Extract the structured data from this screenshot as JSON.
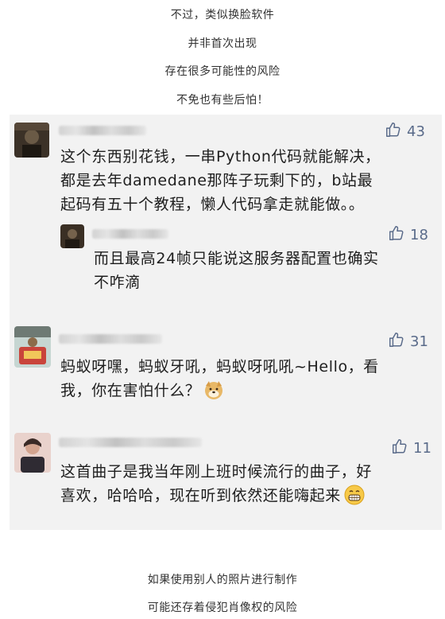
{
  "intro": [
    "不过，类似换脸软件",
    "并非首次出现",
    "存在很多可能性的风险",
    "不免也有些后怕！"
  ],
  "comments": [
    {
      "likes": "43",
      "text": [
        "这个东西别花钱，一串Python代码就能解决，",
        "都是去年damedane那阵子玩剩下的，b站最",
        "起码有五十个教程，懒人代码拿走就能做。。"
      ]
    },
    {
      "likes": "18",
      "text": [
        "而且最高24帧只能说这服务器配置也确实",
        "不咋滴"
      ]
    },
    {
      "likes": "31",
      "text": [
        "蚂蚁呀嘿，蚂蚁牙吼，蚂蚁呀吼吼~Hello，看",
        "我，你在害怕什么？"
      ]
    },
    {
      "likes": "11",
      "text": [
        "这首曲子是我当年刚上班时候流行的曲子，好",
        "喜欢，哈哈哈，现在听到依然还能嗨起来"
      ]
    }
  ],
  "outro": [
    "如果使用别人的照片进行制作",
    "可能还存着侵犯肖像权的风险"
  ],
  "colors": {
    "panel": "#f2f2f2",
    "like": "#5a6b8a"
  }
}
